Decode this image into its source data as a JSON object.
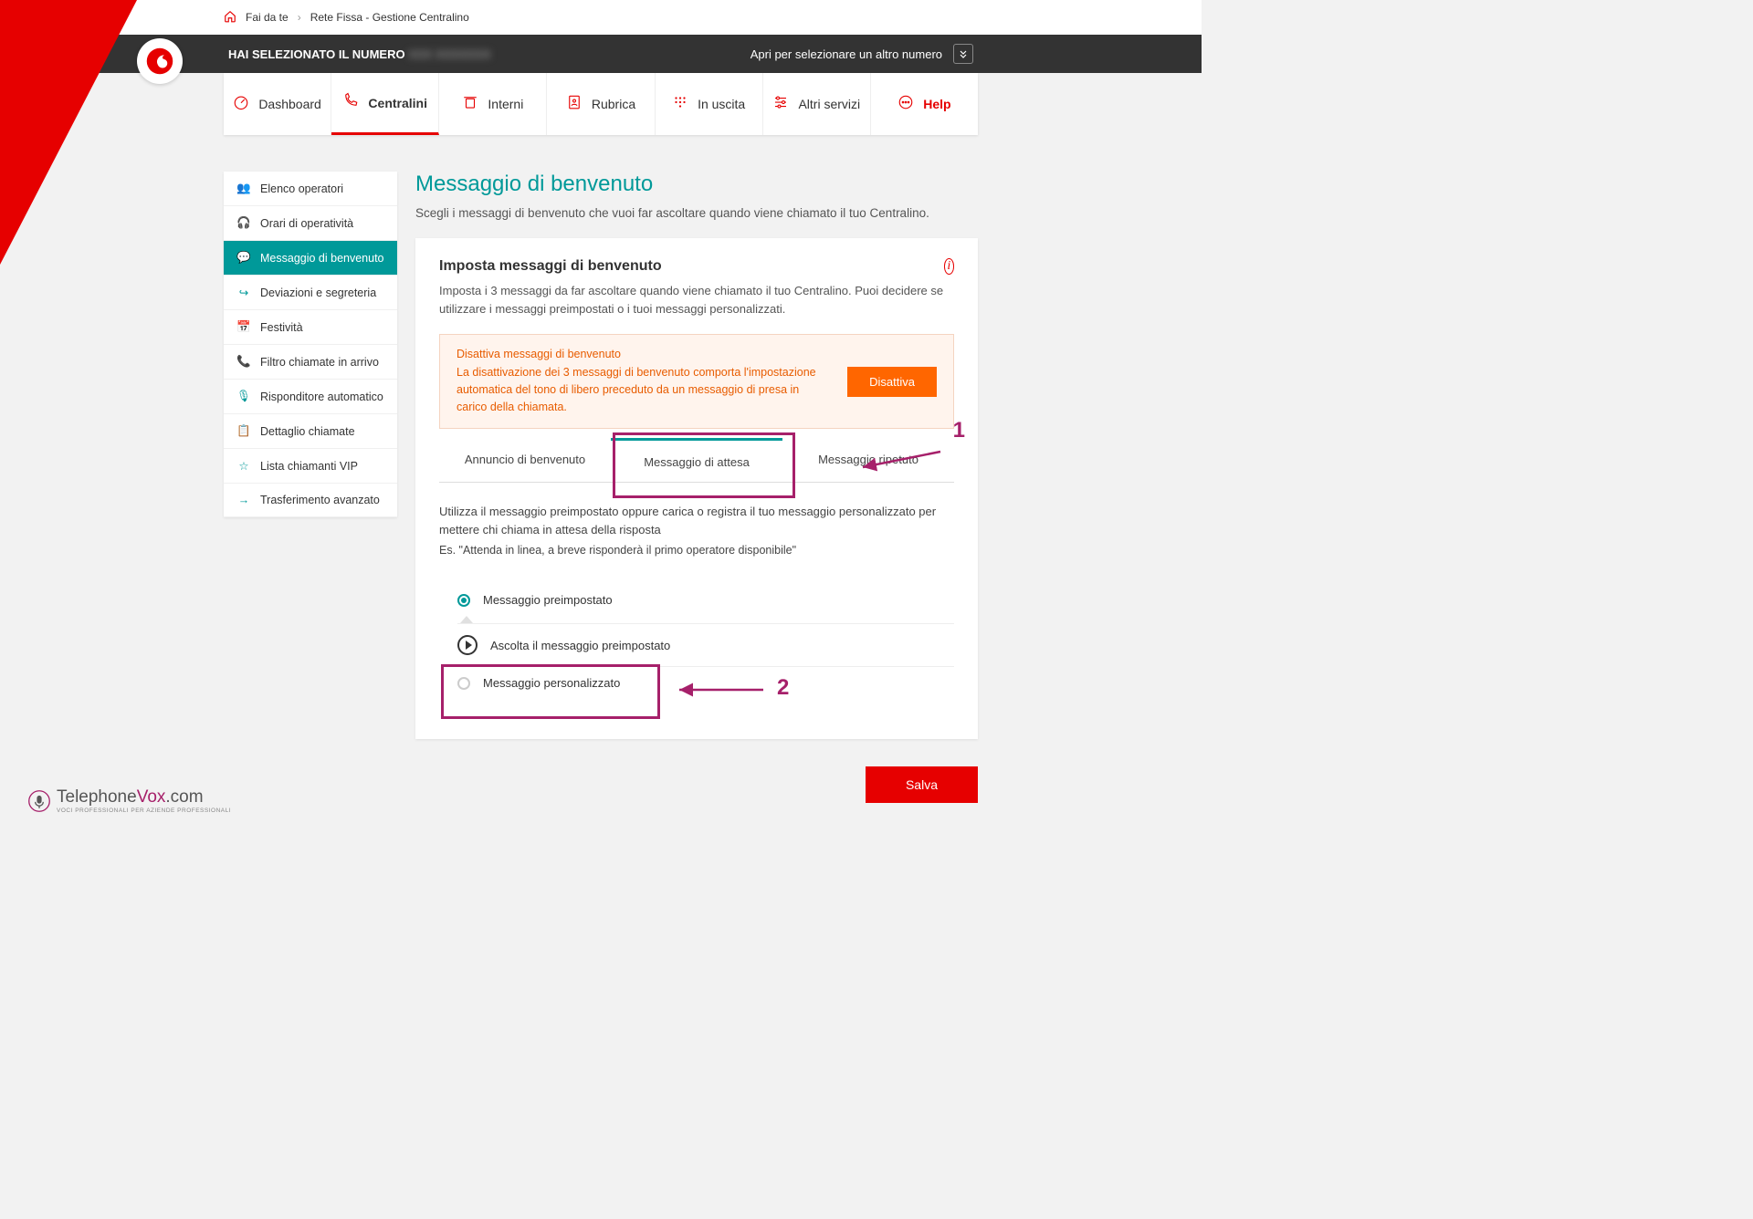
{
  "breadcrumb": {
    "home": "Fai da te",
    "current": "Rete Fissa - Gestione Centralino"
  },
  "darkbar": {
    "left_prefix": "HAI SELEZIONATO IL NUMERO ",
    "left_number": "XXX XXXXXXX",
    "right": "Apri per selezionare un altro numero"
  },
  "tabs": {
    "dashboard": "Dashboard",
    "centralini": "Centralini",
    "interni": "Interni",
    "rubrica": "Rubrica",
    "uscita": "In uscita",
    "altri": "Altri servizi",
    "help": "Help"
  },
  "sidebar": {
    "items": [
      "Elenco operatori",
      "Orari di operatività",
      "Messaggio di benvenuto",
      "Deviazioni e segreteria",
      "Festività",
      "Filtro chiamate in arrivo",
      "Risponditore automatico",
      "Dettaglio chiamate",
      "Lista chiamanti VIP",
      "Trasferimento avanzato"
    ]
  },
  "page": {
    "title": "Messaggio di benvenuto",
    "subtitle": "Scegli i messaggi di benvenuto che vuoi far ascoltare quando viene chiamato il tuo Centralino."
  },
  "card": {
    "title": "Imposta messaggi di benvenuto",
    "desc": "Imposta i 3 messaggi da far ascoltare quando viene chiamato il tuo Centralino. Puoi decidere se utilizzare i messaggi preimpostati o i tuoi messaggi personalizzati.",
    "warn_title": "Disattiva messaggi di benvenuto",
    "warn_text": "La disattivazione dei 3 messaggi di benvenuto comporta l'impostazione automatica del tono di libero preceduto da un messaggio di presa in carico della chiamata.",
    "deactivate": "Disattiva",
    "msg_tabs": {
      "t1": "Annuncio di benvenuto",
      "t2": "Messaggio di attesa",
      "t3": "Messaggio ripetuto"
    },
    "body_text": "Utilizza il messaggio preimpostato oppure carica o registra il tuo messaggio personalizzato per mettere chi chiama in attesa della risposta",
    "body_ex": "Es. \"Attenda in linea, a breve risponderà il primo operatore disponibile\"",
    "radio1": "Messaggio preimpostato",
    "listen": "Ascolta il messaggio preimpostato",
    "radio2": "Messaggio personalizzato"
  },
  "save": "Salva",
  "annot": {
    "one": "1",
    "two": "2"
  },
  "footer": {
    "brand_a": "Telephone",
    "brand_b": "Vox",
    "brand_c": ".com",
    "sub": "VOCI PROFESSIONALI PER AZIENDE PROFESSIONALI"
  }
}
